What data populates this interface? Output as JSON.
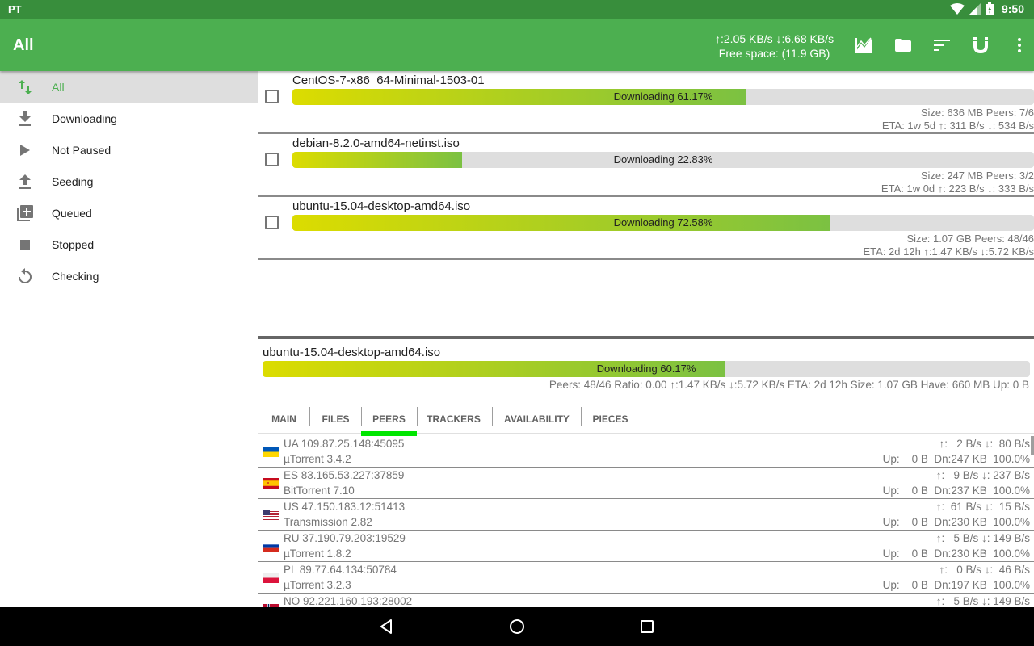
{
  "status_bar": {
    "carrier": "PT",
    "time": "9:50"
  },
  "app_bar": {
    "title": "All",
    "speeds": "↑:2.05 KB/s ↓:6.68 KB/s",
    "free_space": "Free space: (11.9 GB)",
    "actions": [
      "chart-icon",
      "folder-icon",
      "sort-icon",
      "magnet-icon",
      "more-vert-icon"
    ]
  },
  "sidebar": {
    "items": [
      {
        "label": "All",
        "icon": "swap-vert-icon",
        "active": true
      },
      {
        "label": "Downloading",
        "icon": "download-icon"
      },
      {
        "label": "Not Paused",
        "icon": "play-icon"
      },
      {
        "label": "Seeding",
        "icon": "upload-icon"
      },
      {
        "label": "Queued",
        "icon": "queue-add-icon"
      },
      {
        "label": "Stopped",
        "icon": "stop-icon"
      },
      {
        "label": "Checking",
        "icon": "refresh-icon"
      }
    ]
  },
  "torrents": [
    {
      "name": "CentOS-7-x86_64-Minimal-1503-01",
      "status": "Downloading 61.17%",
      "progress": 0.6117,
      "line1": "Size: 636 MB Peers: 7/6",
      "line2": "ETA: 1w 5d ↑: 311 B/s ↓: 534 B/s",
      "checked": false
    },
    {
      "name": "debian-8.2.0-amd64-netinst.iso",
      "status": "Downloading 22.83%",
      "progress": 0.2283,
      "line1": "Size: 247 MB Peers: 3/2",
      "line2": "ETA: 1w 0d ↑: 223 B/s ↓: 333 B/s",
      "checked": false
    },
    {
      "name": "ubuntu-15.04-desktop-amd64.iso",
      "status": "Downloading 72.58%",
      "progress": 0.7258,
      "line1": "Size: 1.07 GB Peers: 48/46",
      "line2": "ETA: 2d 12h ↑:1.47 KB/s ↓:5.72 KB/s",
      "checked": false
    }
  ],
  "detail": {
    "name": "ubuntu-15.04-desktop-amd64.iso",
    "status": "Downloading 60.17%",
    "progress": 0.6017,
    "stats": "Peers: 48/46 Ratio: 0.00 ↑:1.47 KB/s ↓:5.72 KB/s ETA: 2d 12h Size: 1.07 GB Have: 660 MB Up:    0 B",
    "tabs": [
      "MAIN",
      "FILES",
      "PEERS",
      "TRACKERS",
      "AVAILABILITY",
      "PIECES"
    ],
    "active_tab": "PEERS"
  },
  "peers": [
    {
      "country": "UA",
      "address": "UA 109.87.25.148:45095",
      "client": "µTorrent 3.4.2",
      "speed": "↑:   2 B/s ↓:  80 B/s",
      "transfer": "Up:    0 B  Dn:247 KB  100.0%"
    },
    {
      "country": "ES",
      "address": "ES 83.165.53.227:37859",
      "client": "BitTorrent 7.10",
      "speed": "↑:   9 B/s ↓: 237 B/s",
      "transfer": "Up:    0 B  Dn:237 KB  100.0%"
    },
    {
      "country": "US",
      "address": "US 47.150.183.12:51413",
      "client": "Transmission 2.82",
      "speed": "↑:  61 B/s ↓:  15 B/s",
      "transfer": "Up:    0 B  Dn:230 KB  100.0%"
    },
    {
      "country": "RU",
      "address": "RU 37.190.79.203:19529",
      "client": "µTorrent 1.8.2",
      "speed": "↑:   5 B/s ↓: 149 B/s",
      "transfer": "Up:    0 B  Dn:230 KB  100.0%"
    },
    {
      "country": "PL",
      "address": "PL 89.77.64.134:50784",
      "client": "µTorrent 3.2.3",
      "speed": "↑:   0 B/s ↓:  46 B/s",
      "transfer": "Up:    0 B  Dn:197 KB  100.0%"
    },
    {
      "country": "NO",
      "address": "NO 92.221.160.193:28002",
      "client": "",
      "speed": "↑:   5 B/s ↓: 149 B/s",
      "transfer": ""
    }
  ],
  "colors": {
    "primary": "#4caf50",
    "primary_dark": "#388e3c",
    "tab_indicator": "#00e600",
    "progress_start": "#dcdc00",
    "progress_end": "#7bc142"
  }
}
